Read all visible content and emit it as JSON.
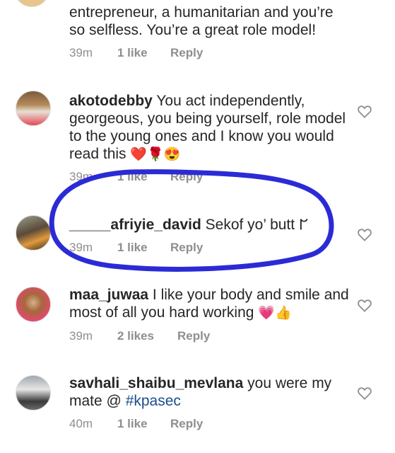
{
  "comments": [
    {
      "username": "",
      "body": "entrepreneur, a humanitarian and you’re so selfless. You’re a great role model!",
      "time": "39m",
      "likes": "1 like",
      "reply": "Reply"
    },
    {
      "username": "akotodebby",
      "body": " You act independently, georgeous, you being yourself, role model to the young ones and I know you would read this ",
      "emoji": "❤️🌹😍",
      "time": "39m",
      "likes": "1 like",
      "reply": "Reply"
    },
    {
      "username": "_____afriyie_david",
      "body": " Sekof yo’ butt 𐐊",
      "time": "39m",
      "likes": "1 like",
      "reply": "Reply"
    },
    {
      "username": "maa_juwaa",
      "body": " I like your body and smile and most of all you hard working ",
      "emoji": "💗👍",
      "time": "39m",
      "likes": "2 likes",
      "reply": "Reply"
    },
    {
      "username": "savhali_shaibu_mevlana",
      "body": " you were my mate @ ",
      "hashtag": "#kpasec",
      "time": "40m",
      "likes": "1 like",
      "reply": "Reply"
    }
  ],
  "colors": {
    "text": "#262626",
    "meta": "#8e8e8e",
    "annotation_circle": "#2b2bd6",
    "hashtag": "#1c4b8c"
  },
  "icons": {
    "like": "heart-outline-icon"
  }
}
